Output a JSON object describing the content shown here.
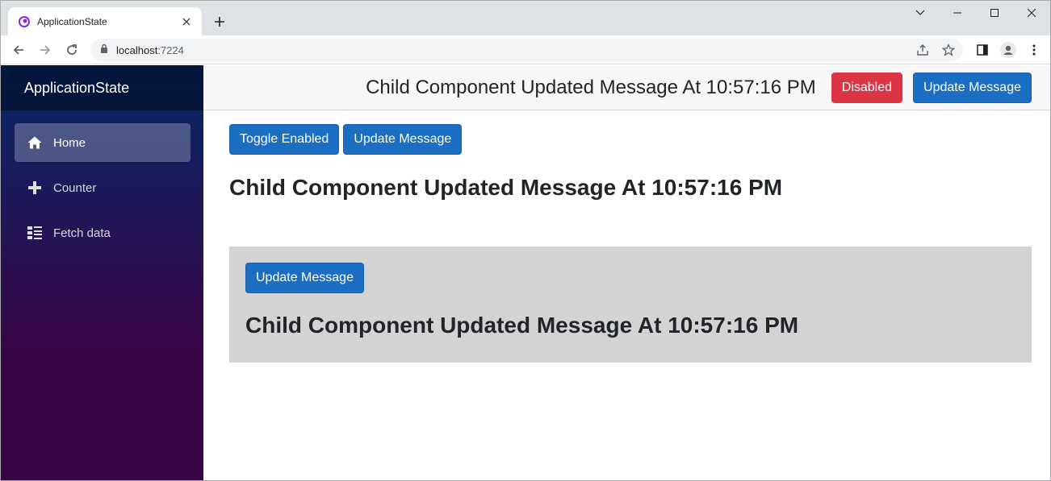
{
  "browser": {
    "tab_title": "ApplicationState",
    "url_host": "localhost",
    "url_port": ":7224"
  },
  "sidebar": {
    "brand": "ApplicationState",
    "items": [
      {
        "label": "Home",
        "icon": "home-icon",
        "active": true
      },
      {
        "label": "Counter",
        "icon": "plus-icon",
        "active": false
      },
      {
        "label": "Fetch data",
        "icon": "list-icon",
        "active": false
      }
    ]
  },
  "top_row": {
    "message": "Child Component Updated Message At 10:57:16 PM",
    "disabled_label": "Disabled",
    "update_label": "Update Message"
  },
  "content": {
    "toggle_label": "Toggle Enabled",
    "update_label": "Update Message",
    "message": "Child Component Updated Message At 10:57:16 PM"
  },
  "child": {
    "update_label": "Update Message",
    "message": "Child Component Updated Message At 10:57:16 PM"
  },
  "colors": {
    "primary": "#1b6ec2",
    "danger": "#dc3545",
    "sidebar_top": "#052767",
    "sidebar_bottom": "#3a0647",
    "child_bg": "#d3d3d3"
  }
}
